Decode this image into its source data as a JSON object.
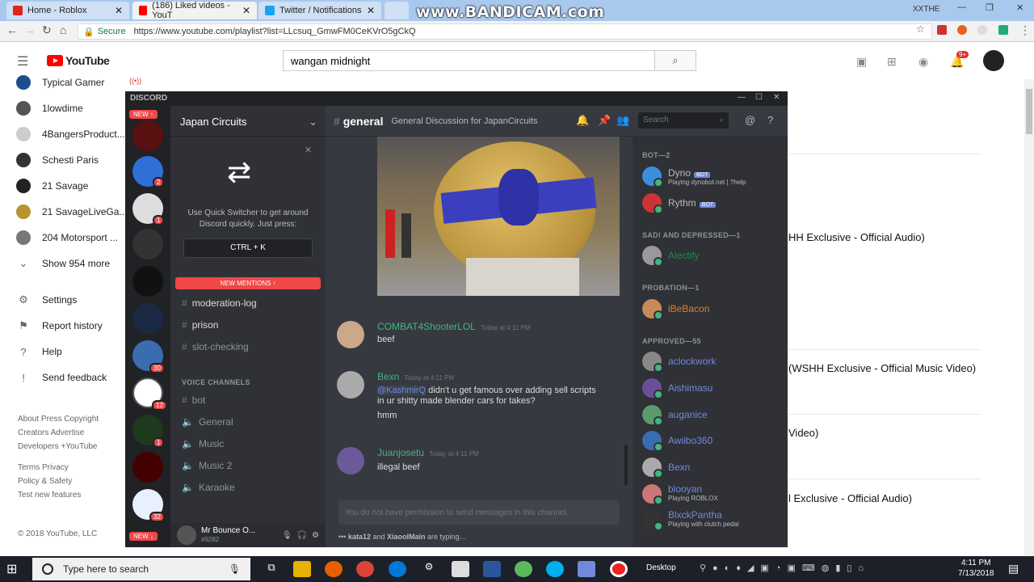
{
  "browser": {
    "tabs": [
      {
        "title": "Home - Roblox",
        "color": "#e2231a"
      },
      {
        "title": "(186) Liked videos - YouT",
        "color": "#ff0000"
      },
      {
        "title": "Twitter / Notifications",
        "color": "#1da1f2"
      }
    ],
    "watermark": "www.BANDICAM.com",
    "window_user": "XXTHE",
    "secure_label": "Secure",
    "url": "https://www.youtube.com/playlist?list=LLcsuq_GmwFM0CeKVrO5gCkQ"
  },
  "youtube": {
    "logo_text": "YouTube",
    "search_value": "wangan midnight",
    "notif_count": "9+",
    "sidebar": [
      {
        "label": "Typical Gamer",
        "icon": "channel-avatar"
      },
      {
        "label": "1lowdime",
        "icon": "channel-avatar"
      },
      {
        "label": "4BangersProduct...",
        "icon": "channel-avatar"
      },
      {
        "label": "Schesti Paris",
        "icon": "channel-avatar"
      },
      {
        "label": "21 Savage",
        "icon": "channel-avatar"
      },
      {
        "label": "21 SavageLiveGa...",
        "icon": "channel-avatar"
      },
      {
        "label": "204 Motorsport ...",
        "icon": "channel-avatar"
      },
      {
        "label": "Show 954 more",
        "icon": "chevron-down"
      },
      {
        "label": "Settings",
        "icon": "gear"
      },
      {
        "label": "Report history",
        "icon": "flag"
      },
      {
        "label": "Help",
        "icon": "help"
      },
      {
        "label": "Send feedback",
        "icon": "feedback"
      }
    ],
    "footer": [
      "About  Press  Copyright",
      "Creators  Advertise",
      "Developers  +YouTube",
      "Terms  Privacy",
      "Policy & Safety",
      "Test new features"
    ],
    "copyright": "© 2018 YouTube, LLC",
    "video_titles": [
      "HH Exclusive - Official Audio)",
      "(WSHH Exclusive - Official Music Video)",
      "Video)",
      "l Exclusive - Official Audio)"
    ]
  },
  "discord": {
    "app_title": "DISCORD",
    "new_pill": "NEW",
    "server_name": "Japan Circuits",
    "quick_switcher_text": "Use Quick Switcher to get around Discord quickly. Just press:",
    "quick_switcher_key": "CTRL + K",
    "new_mentions": "NEW MENTIONS",
    "text_channels": [
      {
        "name": "moderation-log",
        "bright": true
      },
      {
        "name": "prison",
        "bright": true
      },
      {
        "name": "slot-checking",
        "bright": false
      }
    ],
    "voice_label": "VOICE CHANNELS",
    "voice_channels": [
      "bot",
      "General",
      "Music",
      "Music 2",
      "Karaoke"
    ],
    "guild_badges": [
      "2",
      "1",
      "30",
      "12",
      "1",
      "32"
    ],
    "user": {
      "name": "Mr Bounce O...",
      "tag": "#9282"
    },
    "channel": {
      "name": "general",
      "topic": "General Discussion for JapanCircuits"
    },
    "search_placeholder": "Search",
    "messages": [
      {
        "author": "COMBAT4ShooterLOL",
        "time": "Today at 4:11 PM",
        "lines": [
          "beef"
        ]
      },
      {
        "author": "Bexn",
        "time": "Today at 4:11 PM",
        "mention": "@KashmirQ",
        "lines": [
          "didn't u get famous over adding sell scripts in ur shitty made blender cars for takes?",
          "hmm"
        ]
      },
      {
        "author": "Juanjosetu",
        "time": "Today at 4:11 PM",
        "lines": [
          "illegal beef"
        ]
      }
    ],
    "input_placeholder": "You do not have permission to send messages in this channel.",
    "typing": {
      "users": [
        "kata12",
        "XiaoolMain"
      ],
      "suffix": "are typing..."
    },
    "member_groups": [
      {
        "label": "BOT—2",
        "members": [
          {
            "name": "Dyno",
            "bot": true,
            "status": "Playing dynobot.net | ?help"
          },
          {
            "name": "Rythm",
            "bot": true,
            "status": ""
          }
        ]
      },
      {
        "label": "SAD! AND DEPRESSED—1",
        "members": [
          {
            "name": "Alectify",
            "bot": false,
            "status": ""
          }
        ]
      },
      {
        "label": "PROBATION—1",
        "members": [
          {
            "name": "iBeBacon",
            "bot": false,
            "status": ""
          }
        ]
      },
      {
        "label": "APPROVED—55",
        "members": [
          {
            "name": "aclockwork",
            "bot": false,
            "status": ""
          },
          {
            "name": "Aishimasu",
            "bot": false,
            "status": ""
          },
          {
            "name": "auganice",
            "bot": false,
            "status": ""
          },
          {
            "name": "Awiibo360",
            "bot": false,
            "status": ""
          },
          {
            "name": "Bexn",
            "bot": false,
            "status": ""
          },
          {
            "name": "blooyan",
            "bot": false,
            "status": "Playing ROBLOX"
          },
          {
            "name": "BlxckPantha",
            "bot": false,
            "status": "Playing with clutch pedal"
          }
        ]
      }
    ],
    "bot_tag": "BOT"
  },
  "taskbar": {
    "search_placeholder": "Type here to search",
    "desktop_label": "Desktop",
    "time": "4:11 PM",
    "date": "7/13/2018"
  }
}
